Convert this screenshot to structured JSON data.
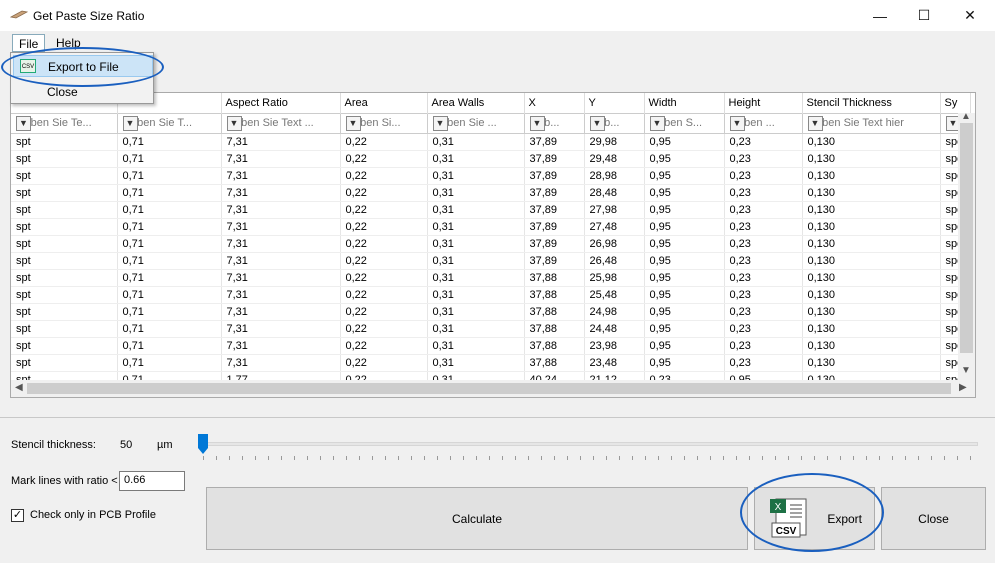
{
  "window": {
    "title": "Get Paste Size Ratio",
    "minimize": "—",
    "maximize": "☐",
    "close": "✕"
  },
  "menu": {
    "file": "File",
    "help": "Help",
    "export_to_file": "Export to File",
    "close": "Close",
    "export_icon_text": "CSV"
  },
  "grid": {
    "columns": [
      "",
      "",
      "Aspect Ratio",
      "Area",
      "Area Walls",
      "X",
      "Y",
      "Width",
      "Height",
      "Stencil Thickness",
      "Sy"
    ],
    "filters": [
      "Geben Sie Te...",
      "Geben Sie T...",
      "Geben Sie Text ...",
      "Geben Si...",
      "Geben Sie ...",
      "Geb...",
      "Geb...",
      "Geben S...",
      "Geben ...",
      "Geben Sie Text hier",
      "Ge"
    ],
    "rows": [
      [
        "spt",
        "0,71",
        "7,31",
        "0,22",
        "0,31",
        "37,89",
        "29,98",
        "0,95",
        "0,23",
        "0,130",
        "spe"
      ],
      [
        "spt",
        "0,71",
        "7,31",
        "0,22",
        "0,31",
        "37,89",
        "29,48",
        "0,95",
        "0,23",
        "0,130",
        "spe"
      ],
      [
        "spt",
        "0,71",
        "7,31",
        "0,22",
        "0,31",
        "37,89",
        "28,98",
        "0,95",
        "0,23",
        "0,130",
        "spe"
      ],
      [
        "spt",
        "0,71",
        "7,31",
        "0,22",
        "0,31",
        "37,89",
        "28,48",
        "0,95",
        "0,23",
        "0,130",
        "spe"
      ],
      [
        "spt",
        "0,71",
        "7,31",
        "0,22",
        "0,31",
        "37,89",
        "27,98",
        "0,95",
        "0,23",
        "0,130",
        "spe"
      ],
      [
        "spt",
        "0,71",
        "7,31",
        "0,22",
        "0,31",
        "37,89",
        "27,48",
        "0,95",
        "0,23",
        "0,130",
        "spe"
      ],
      [
        "spt",
        "0,71",
        "7,31",
        "0,22",
        "0,31",
        "37,89",
        "26,98",
        "0,95",
        "0,23",
        "0,130",
        "spe"
      ],
      [
        "spt",
        "0,71",
        "7,31",
        "0,22",
        "0,31",
        "37,89",
        "26,48",
        "0,95",
        "0,23",
        "0,130",
        "spe"
      ],
      [
        "spt",
        "0,71",
        "7,31",
        "0,22",
        "0,31",
        "37,88",
        "25,98",
        "0,95",
        "0,23",
        "0,130",
        "spe"
      ],
      [
        "spt",
        "0,71",
        "7,31",
        "0,22",
        "0,31",
        "37,88",
        "25,48",
        "0,95",
        "0,23",
        "0,130",
        "spe"
      ],
      [
        "spt",
        "0,71",
        "7,31",
        "0,22",
        "0,31",
        "37,88",
        "24,98",
        "0,95",
        "0,23",
        "0,130",
        "spe"
      ],
      [
        "spt",
        "0,71",
        "7,31",
        "0,22",
        "0,31",
        "37,88",
        "24,48",
        "0,95",
        "0,23",
        "0,130",
        "spe"
      ],
      [
        "spt",
        "0,71",
        "7,31",
        "0,22",
        "0,31",
        "37,88",
        "23,98",
        "0,95",
        "0,23",
        "0,130",
        "spe"
      ],
      [
        "spt",
        "0,71",
        "7,31",
        "0,22",
        "0,31",
        "37,88",
        "23,48",
        "0,95",
        "0,23",
        "0,130",
        "spe"
      ],
      [
        "spt",
        "0,71",
        "1,77",
        "0,22",
        "0,31",
        "40,24",
        "21,12",
        "0,23",
        "0,95",
        "0,130",
        "spe"
      ]
    ]
  },
  "controls": {
    "stencil_label": "Stencil thickness:",
    "stencil_value": "50",
    "stencil_unit": "µm",
    "stencil_slider_fraction": 0.0,
    "mark_label": "Mark lines with ratio <",
    "mark_value": "0.66",
    "pcb_label": "Check only in PCB Profile",
    "pcb_checked": true,
    "calculate": "Calculate",
    "export": "Export",
    "close": "Close",
    "csv_icon_text": "CSV"
  },
  "colors": {
    "accent": "#0078d7",
    "highlight_oval": "#1a5fbf"
  }
}
